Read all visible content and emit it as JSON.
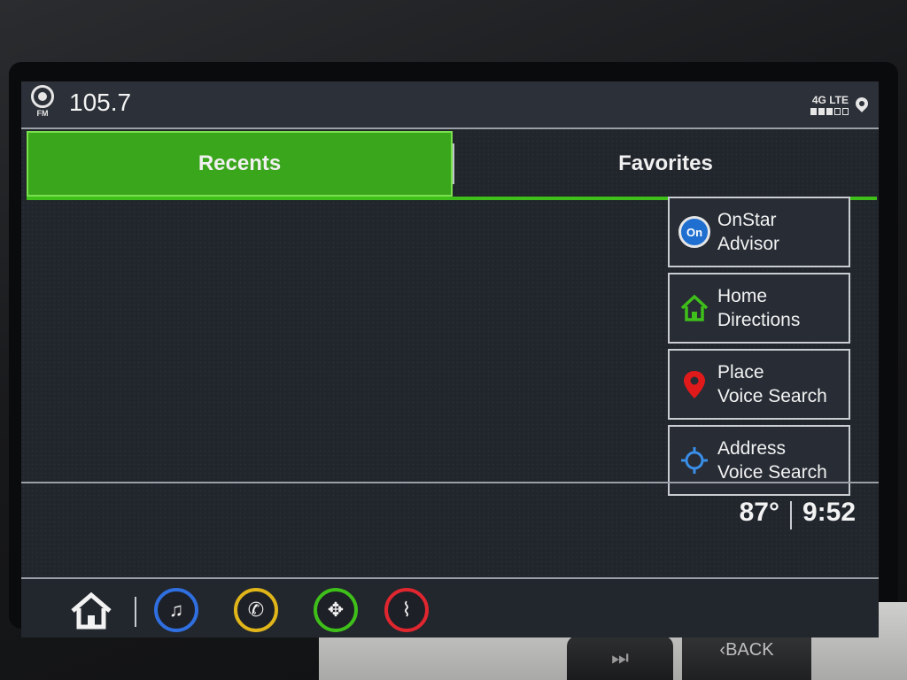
{
  "status_bar": {
    "fm_label": "FM",
    "station": "105.7",
    "network": "4G LTE",
    "signal_bars": 3,
    "signal_max": 5
  },
  "tabs": [
    {
      "label": "Recents",
      "active": true
    },
    {
      "label": "Favorites",
      "active": false
    }
  ],
  "shortcuts": [
    {
      "line1": "OnStar",
      "line2": "Advisor",
      "icon": "onstar-icon",
      "badge": "On",
      "color": "#1f6fd1"
    },
    {
      "line1": "Home",
      "line2": "Directions",
      "icon": "home-icon",
      "color": "#3fbf1a"
    },
    {
      "line1": "Place",
      "line2": "Voice Search",
      "icon": "map-pin-icon",
      "color": "#e01a1a"
    },
    {
      "line1": "Address",
      "line2": "Voice Search",
      "icon": "crosshair-icon",
      "color": "#3a8ee6"
    }
  ],
  "info": {
    "temperature": "87°",
    "time": "9:52"
  },
  "app_bar": [
    {
      "name": "audio-app-icon",
      "glyph": "♫",
      "color": "#2f6fe0"
    },
    {
      "name": "phone-app-icon",
      "glyph": "✆",
      "color": "#e0b51a"
    },
    {
      "name": "navigation-app-icon",
      "glyph": "✥",
      "color": "#3fbf1a"
    },
    {
      "name": "climate-app-icon",
      "glyph": "⌇",
      "color": "#e0262f"
    }
  ],
  "hardware": {
    "back_label": "BACK"
  }
}
